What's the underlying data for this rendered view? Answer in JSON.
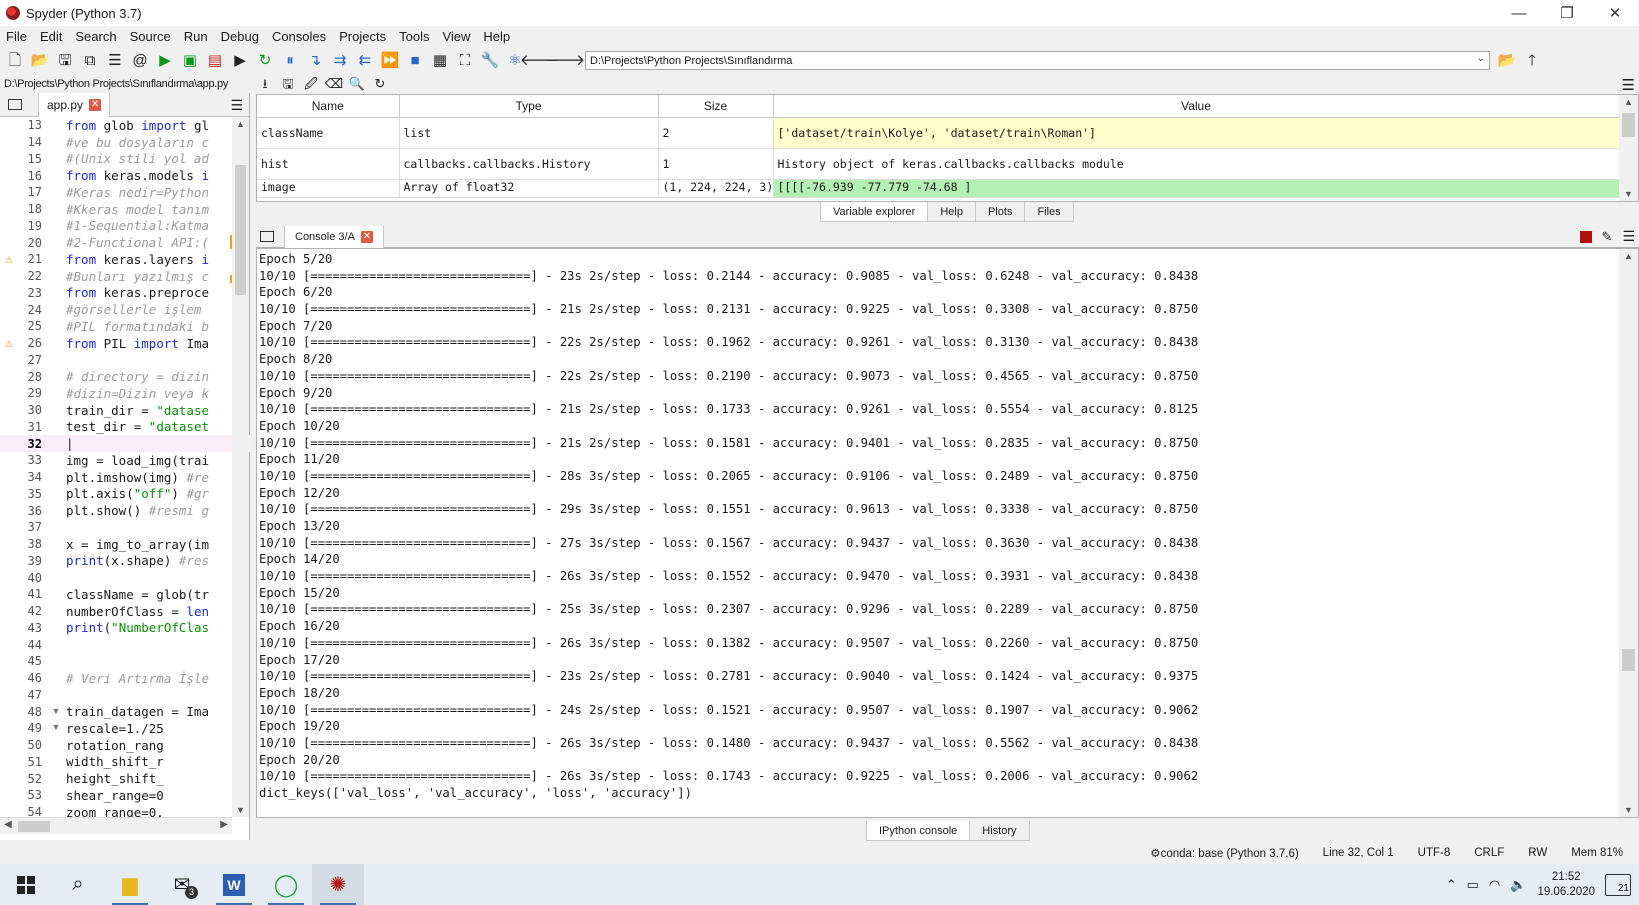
{
  "window": {
    "title": "Spyder (Python 3.7)",
    "minimize": "—",
    "restore": "❐",
    "close": "✕"
  },
  "menu": [
    "File",
    "Edit",
    "Search",
    "Source",
    "Run",
    "Debug",
    "Consoles",
    "Projects",
    "Tools",
    "View",
    "Help"
  ],
  "toolbar": {
    "working_dir": "D:\\Projects\\Python Projects\\Sınıflandırma"
  },
  "editor": {
    "file_path": "D:\\Projects\\Python Projects\\Sınıflandırma\\app.py",
    "tab_label": "app.py",
    "lines": [
      {
        "n": "13",
        "warn": false,
        "fold": "",
        "cls": "",
        "parts": [
          [
            "kw",
            "from "
          ],
          [
            "",
            "glob "
          ],
          [
            "kw",
            "import "
          ],
          [
            "",
            "gl"
          ]
        ]
      },
      {
        "n": "14",
        "warn": false,
        "fold": "",
        "cls": "",
        "parts": [
          [
            "cm",
            "#ve bu dosyaların c"
          ]
        ]
      },
      {
        "n": "15",
        "warn": false,
        "fold": "",
        "cls": "",
        "parts": [
          [
            "cm",
            "#(Unix stili yol ad"
          ]
        ]
      },
      {
        "n": "16",
        "warn": false,
        "fold": "",
        "cls": "",
        "parts": [
          [
            "kw",
            "from "
          ],
          [
            "",
            "keras.models "
          ],
          [
            "kw",
            "i"
          ]
        ]
      },
      {
        "n": "17",
        "warn": false,
        "fold": "",
        "cls": "",
        "parts": [
          [
            "cm",
            "#Keras nedir=Python"
          ]
        ]
      },
      {
        "n": "18",
        "warn": false,
        "fold": "",
        "cls": "",
        "parts": [
          [
            "cm",
            "#Kkeras model tanım"
          ]
        ]
      },
      {
        "n": "19",
        "warn": false,
        "fold": "",
        "cls": "",
        "parts": [
          [
            "cm",
            "#1-Sequential:Katma"
          ]
        ]
      },
      {
        "n": "20",
        "warn": false,
        "fold": "",
        "cls": "",
        "parts": [
          [
            "cm",
            "#2-Functional API:("
          ]
        ]
      },
      {
        "n": "21",
        "warn": true,
        "fold": "",
        "cls": "",
        "parts": [
          [
            "kw",
            "from "
          ],
          [
            "",
            "keras.layers "
          ],
          [
            "kw",
            "i"
          ]
        ]
      },
      {
        "n": "22",
        "warn": false,
        "fold": "",
        "cls": "",
        "parts": [
          [
            "cm",
            "#Bunları yazılmış c"
          ]
        ]
      },
      {
        "n": "23",
        "warn": false,
        "fold": "",
        "cls": "",
        "parts": [
          [
            "kw",
            "from "
          ],
          [
            "",
            "keras.preproce"
          ]
        ]
      },
      {
        "n": "24",
        "warn": false,
        "fold": "",
        "cls": "",
        "parts": [
          [
            "cm",
            "#görsellerle işlem"
          ]
        ]
      },
      {
        "n": "25",
        "warn": false,
        "fold": "",
        "cls": "",
        "parts": [
          [
            "cm",
            "#PIL formatındaki b"
          ]
        ]
      },
      {
        "n": "26",
        "warn": true,
        "fold": "",
        "cls": "",
        "parts": [
          [
            "kw",
            "from "
          ],
          [
            "",
            "PIL "
          ],
          [
            "kw",
            "import "
          ],
          [
            "",
            "Ima"
          ]
        ]
      },
      {
        "n": "27",
        "warn": false,
        "fold": "",
        "cls": "",
        "parts": [
          [
            "",
            ""
          ]
        ]
      },
      {
        "n": "28",
        "warn": false,
        "fold": "",
        "cls": "",
        "parts": [
          [
            "cm",
            "# directory = dizin"
          ]
        ]
      },
      {
        "n": "29",
        "warn": false,
        "fold": "",
        "cls": "",
        "parts": [
          [
            "cm",
            "#dizin=Dizin veya k"
          ]
        ]
      },
      {
        "n": "30",
        "warn": false,
        "fold": "",
        "cls": "",
        "parts": [
          [
            "",
            "train_dir = "
          ],
          [
            "st",
            "\"datase"
          ]
        ]
      },
      {
        "n": "31",
        "warn": false,
        "fold": "",
        "cls": "",
        "parts": [
          [
            "",
            "test_dir = "
          ],
          [
            "st",
            "\"dataset"
          ]
        ]
      },
      {
        "n": "32",
        "warn": false,
        "fold": "",
        "cls": "current",
        "parts": [
          [
            "",
            "|"
          ]
        ]
      },
      {
        "n": "33",
        "warn": false,
        "fold": "",
        "cls": "",
        "parts": [
          [
            "",
            "img = load_img(trai"
          ]
        ]
      },
      {
        "n": "34",
        "warn": false,
        "fold": "",
        "cls": "",
        "parts": [
          [
            "",
            "plt.imshow(img) "
          ],
          [
            "cm",
            "#re"
          ]
        ]
      },
      {
        "n": "35",
        "warn": false,
        "fold": "",
        "cls": "",
        "parts": [
          [
            "",
            "plt.axis("
          ],
          [
            "st",
            "\"off\""
          ],
          [
            "",
            ") "
          ],
          [
            "cm",
            "#gr"
          ]
        ]
      },
      {
        "n": "36",
        "warn": false,
        "fold": "",
        "cls": "",
        "parts": [
          [
            "",
            "plt.show() "
          ],
          [
            "cm",
            "#resmi g"
          ]
        ]
      },
      {
        "n": "37",
        "warn": false,
        "fold": "",
        "cls": "",
        "parts": [
          [
            "",
            ""
          ]
        ]
      },
      {
        "n": "38",
        "warn": false,
        "fold": "",
        "cls": "",
        "parts": [
          [
            "",
            "x = img_to_array(im"
          ]
        ]
      },
      {
        "n": "39",
        "warn": false,
        "fold": "",
        "cls": "",
        "parts": [
          [
            "kw",
            "print"
          ],
          [
            "",
            "(x.shape) "
          ],
          [
            "cm",
            "#res"
          ]
        ]
      },
      {
        "n": "40",
        "warn": false,
        "fold": "",
        "cls": "",
        "parts": [
          [
            "",
            ""
          ]
        ]
      },
      {
        "n": "41",
        "warn": false,
        "fold": "",
        "cls": "",
        "parts": [
          [
            "",
            "className = glob(tr"
          ]
        ]
      },
      {
        "n": "42",
        "warn": false,
        "fold": "",
        "cls": "",
        "parts": [
          [
            "",
            "numberOfClass = "
          ],
          [
            "kw",
            "len"
          ]
        ]
      },
      {
        "n": "43",
        "warn": false,
        "fold": "",
        "cls": "",
        "parts": [
          [
            "kw",
            "print"
          ],
          [
            "",
            "("
          ],
          [
            "st",
            "\"NumberOfClas"
          ]
        ]
      },
      {
        "n": "44",
        "warn": false,
        "fold": "",
        "cls": "",
        "parts": [
          [
            "",
            ""
          ]
        ]
      },
      {
        "n": "45",
        "warn": false,
        "fold": "",
        "cls": "",
        "parts": [
          [
            "",
            ""
          ]
        ]
      },
      {
        "n": "46",
        "warn": false,
        "fold": "",
        "cls": "",
        "parts": [
          [
            "cm",
            "# Veri Artırma İşle"
          ]
        ]
      },
      {
        "n": "47",
        "warn": false,
        "fold": "",
        "cls": "",
        "parts": [
          [
            "",
            ""
          ]
        ]
      },
      {
        "n": "48",
        "warn": false,
        "fold": "▼",
        "cls": "",
        "parts": [
          [
            "",
            "train_datagen = Ima"
          ]
        ]
      },
      {
        "n": "49",
        "warn": false,
        "fold": "▼",
        "cls": "",
        "parts": [
          [
            "",
            "      rescale=1./25"
          ]
        ]
      },
      {
        "n": "50",
        "warn": false,
        "fold": "",
        "cls": "",
        "parts": [
          [
            "",
            "      rotation_rang"
          ]
        ]
      },
      {
        "n": "51",
        "warn": false,
        "fold": "",
        "cls": "",
        "parts": [
          [
            "",
            "      width_shift_r"
          ]
        ]
      },
      {
        "n": "52",
        "warn": false,
        "fold": "",
        "cls": "",
        "parts": [
          [
            "",
            "      height_shift_"
          ]
        ]
      },
      {
        "n": "53",
        "warn": false,
        "fold": "",
        "cls": "",
        "parts": [
          [
            "",
            "      shear_range=0"
          ]
        ]
      },
      {
        "n": "54",
        "warn": false,
        "fold": "",
        "cls": "",
        "parts": [
          [
            "",
            "      zoom_range=0."
          ]
        ]
      }
    ]
  },
  "variable_explorer": {
    "headers": [
      "Name",
      "Type",
      "Size",
      "Value"
    ],
    "rows": [
      {
        "name": "className",
        "type": "list",
        "size": "2",
        "value": "['dataset/train\\Kolye', 'dataset/train\\Roman']",
        "style": "r-yellow"
      },
      {
        "name": "hist",
        "type": "callbacks.callbacks.History",
        "size": "1",
        "value": "History object of keras.callbacks.callbacks module",
        "style": ""
      },
      {
        "name": "image",
        "type": "Array of float32",
        "size": "(1, 224, 224, 3)",
        "value": "[[[[-76.939     -77.779     -74.68      ]",
        "style": "r-green r-partial"
      }
    ],
    "tabs": [
      {
        "label": "Variable explorer",
        "active": true
      },
      {
        "label": "Help",
        "active": false
      },
      {
        "label": "Plots",
        "active": false
      },
      {
        "label": "Files",
        "active": false
      }
    ]
  },
  "console": {
    "tab_label": "Console 3/A",
    "lines": [
      "Epoch 5/20",
      "10/10 [==============================] - 23s 2s/step - loss: 0.2144 - accuracy: 0.9085 - val_loss: 0.6248 - val_accuracy: 0.8438",
      "Epoch 6/20",
      "10/10 [==============================] - 21s 2s/step - loss: 0.2131 - accuracy: 0.9225 - val_loss: 0.3308 - val_accuracy: 0.8750",
      "Epoch 7/20",
      "10/10 [==============================] - 22s 2s/step - loss: 0.1962 - accuracy: 0.9261 - val_loss: 0.3130 - val_accuracy: 0.8438",
      "Epoch 8/20",
      "10/10 [==============================] - 22s 2s/step - loss: 0.2190 - accuracy: 0.9073 - val_loss: 0.4565 - val_accuracy: 0.8750",
      "Epoch 9/20",
      "10/10 [==============================] - 21s 2s/step - loss: 0.1733 - accuracy: 0.9261 - val_loss: 0.5554 - val_accuracy: 0.8125",
      "Epoch 10/20",
      "10/10 [==============================] - 21s 2s/step - loss: 0.1581 - accuracy: 0.9401 - val_loss: 0.2835 - val_accuracy: 0.8750",
      "Epoch 11/20",
      "10/10 [==============================] - 28s 3s/step - loss: 0.2065 - accuracy: 0.9106 - val_loss: 0.2489 - val_accuracy: 0.8750",
      "Epoch 12/20",
      "10/10 [==============================] - 29s 3s/step - loss: 0.1551 - accuracy: 0.9613 - val_loss: 0.3338 - val_accuracy: 0.8750",
      "Epoch 13/20",
      "10/10 [==============================] - 27s 3s/step - loss: 0.1567 - accuracy: 0.9437 - val_loss: 0.3630 - val_accuracy: 0.8438",
      "Epoch 14/20",
      "10/10 [==============================] - 26s 3s/step - loss: 0.1552 - accuracy: 0.9470 - val_loss: 0.3931 - val_accuracy: 0.8438",
      "Epoch 15/20",
      "10/10 [==============================] - 25s 3s/step - loss: 0.2307 - accuracy: 0.9296 - val_loss: 0.2289 - val_accuracy: 0.8750",
      "Epoch 16/20",
      "10/10 [==============================] - 26s 3s/step - loss: 0.1382 - accuracy: 0.9507 - val_loss: 0.2260 - val_accuracy: 0.8750",
      "Epoch 17/20",
      "10/10 [==============================] - 23s 2s/step - loss: 0.2781 - accuracy: 0.9040 - val_loss: 0.1424 - val_accuracy: 0.9375",
      "Epoch 18/20",
      "10/10 [==============================] - 24s 2s/step - loss: 0.1521 - accuracy: 0.9507 - val_loss: 0.1907 - val_accuracy: 0.9062",
      "Epoch 19/20",
      "10/10 [==============================] - 26s 3s/step - loss: 0.1480 - accuracy: 0.9437 - val_loss: 0.5562 - val_accuracy: 0.8438",
      "Epoch 20/20",
      "10/10 [==============================] - 26s 3s/step - loss: 0.1743 - accuracy: 0.9225 - val_loss: 0.2006 - val_accuracy: 0.9062",
      "dict_keys(['val_loss', 'val_accuracy', 'loss', 'accuracy'])"
    ],
    "tabs": [
      {
        "label": "IPython console",
        "active": true
      },
      {
        "label": "History",
        "active": false
      }
    ]
  },
  "statusbar": {
    "conda": "⚙conda: base (Python 3.7.6)",
    "cursor": "Line 32, Col 1",
    "encoding": "UTF-8",
    "eol": "CRLF",
    "rw": "RW",
    "mem": "Mem 81%"
  },
  "taskbar": {
    "mail_badge": "3",
    "time": "21:52",
    "date": "19.06.2020",
    "notifications": "21"
  }
}
